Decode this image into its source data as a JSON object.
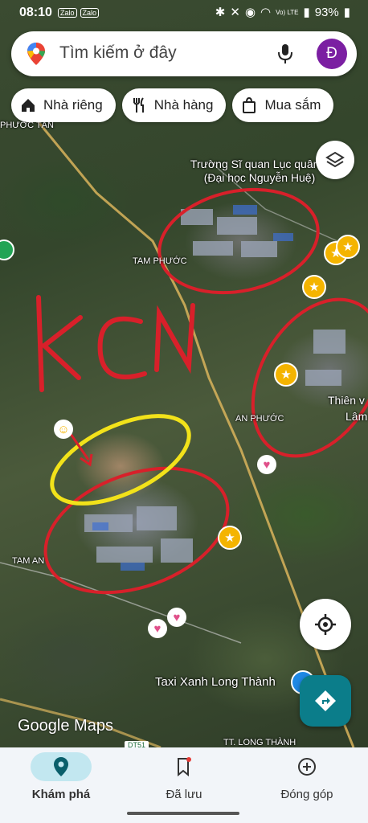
{
  "status_bar": {
    "time": "08:10",
    "apps": [
      "Zalo",
      "Zalo"
    ],
    "network": "Vo) LTE",
    "battery": "93%"
  },
  "search": {
    "placeholder": "Tìm kiếm ở đây",
    "avatar_letter": "Đ"
  },
  "chips": [
    {
      "label": "Nhà riêng",
      "icon": "home-icon"
    },
    {
      "label": "Nhà hàng",
      "icon": "restaurant-icon"
    },
    {
      "label": "Mua sắm",
      "icon": "shopping-bag-icon"
    }
  ],
  "map_labels": {
    "phuoc_tan": "PHƯỚC TÂN",
    "school": "Trường Sĩ quan Lục quân 2 (Đại học Nguyễn Huệ)",
    "tam_phuoc": "TAM PHƯỚC",
    "an_phuoc": "AN PHƯỚC",
    "thien": "Thiên v",
    "lam": "Lâm",
    "tam_an": "TAM AN",
    "taxi": "Taxi Xanh Long Thành",
    "long_thanh": "TT. LONG THÀNH",
    "road": "DT51"
  },
  "annotation": {
    "text": "KCN",
    "color": "#d8202a",
    "highlight_color": "#f2e21a"
  },
  "google_logo": "Google Maps",
  "bottom_nav": [
    {
      "label": "Khám phá",
      "icon": "explore-pin-icon",
      "active": true
    },
    {
      "label": "Đã lưu",
      "icon": "bookmark-icon",
      "active": false
    },
    {
      "label": "Đóng góp",
      "icon": "add-circle-icon",
      "active": false
    }
  ],
  "colors": {
    "accent": "#0b7d8a",
    "active_pill": "#c2e7f0",
    "avatar": "#7b1fa2",
    "star": "#f4b400",
    "heart": "#e0508a"
  }
}
